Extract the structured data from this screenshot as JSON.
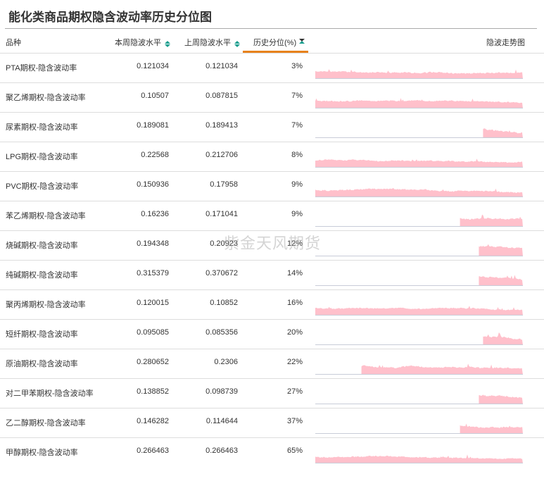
{
  "title": "能化类商品期权隐含波动率历史分位图",
  "watermark": "紫金天风期货",
  "headers": {
    "name": "品种",
    "current": "本周隐波水平",
    "previous": "上周隐波水平",
    "percentile": "历史分位(%)",
    "trend": "隐波走势图"
  },
  "colors": {
    "accent": "#e8821c",
    "sort": "#1a9e8e",
    "spark": "#ffc0cb"
  },
  "rows": [
    {
      "name": "PTA期权-隐含波动率",
      "current": "0.121034",
      "previous": "0.121034",
      "percentile": "3%",
      "trend_start": 0
    },
    {
      "name": "聚乙烯期权-隐含波动率",
      "current": "0.10507",
      "previous": "0.087815",
      "percentile": "7%",
      "trend_start": 0
    },
    {
      "name": "尿素期权-隐含波动率",
      "current": "0.189081",
      "previous": "0.189413",
      "percentile": "7%",
      "trend_start": 0.8
    },
    {
      "name": "LPG期权-隐含波动率",
      "current": "0.22568",
      "previous": "0.212706",
      "percentile": "8%",
      "trend_start": 0
    },
    {
      "name": "PVC期权-隐含波动率",
      "current": "0.150936",
      "previous": "0.17958",
      "percentile": "9%",
      "trend_start": 0
    },
    {
      "name": "苯乙烯期权-隐含波动率",
      "current": "0.16236",
      "previous": "0.171041",
      "percentile": "9%",
      "trend_start": 0.69
    },
    {
      "name": "烧碱期权-隐含波动率",
      "current": "0.194348",
      "previous": "0.20923",
      "percentile": "12%",
      "trend_start": 0.78
    },
    {
      "name": "纯碱期权-隐含波动率",
      "current": "0.315379",
      "previous": "0.370672",
      "percentile": "14%",
      "trend_start": 0.78
    },
    {
      "name": "聚丙烯期权-隐含波动率",
      "current": "0.120015",
      "previous": "0.10852",
      "percentile": "16%",
      "trend_start": 0
    },
    {
      "name": "短纤期权-隐含波动率",
      "current": "0.095085",
      "previous": "0.085356",
      "percentile": "20%",
      "trend_start": 0.8
    },
    {
      "name": "原油期权-隐含波动率",
      "current": "0.280652",
      "previous": "0.2306",
      "percentile": "22%",
      "trend_start": 0.22
    },
    {
      "name": "对二甲苯期权-隐含波动率",
      "current": "0.138852",
      "previous": "0.098739",
      "percentile": "27%",
      "trend_start": 0.78
    },
    {
      "name": "乙二醇期权-隐含波动率",
      "current": "0.146282",
      "previous": "0.114644",
      "percentile": "37%",
      "trend_start": 0.69
    },
    {
      "name": "甲醇期权-隐含波动率",
      "current": "0.266463",
      "previous": "0.266463",
      "percentile": "65%",
      "trend_start": 0
    }
  ]
}
